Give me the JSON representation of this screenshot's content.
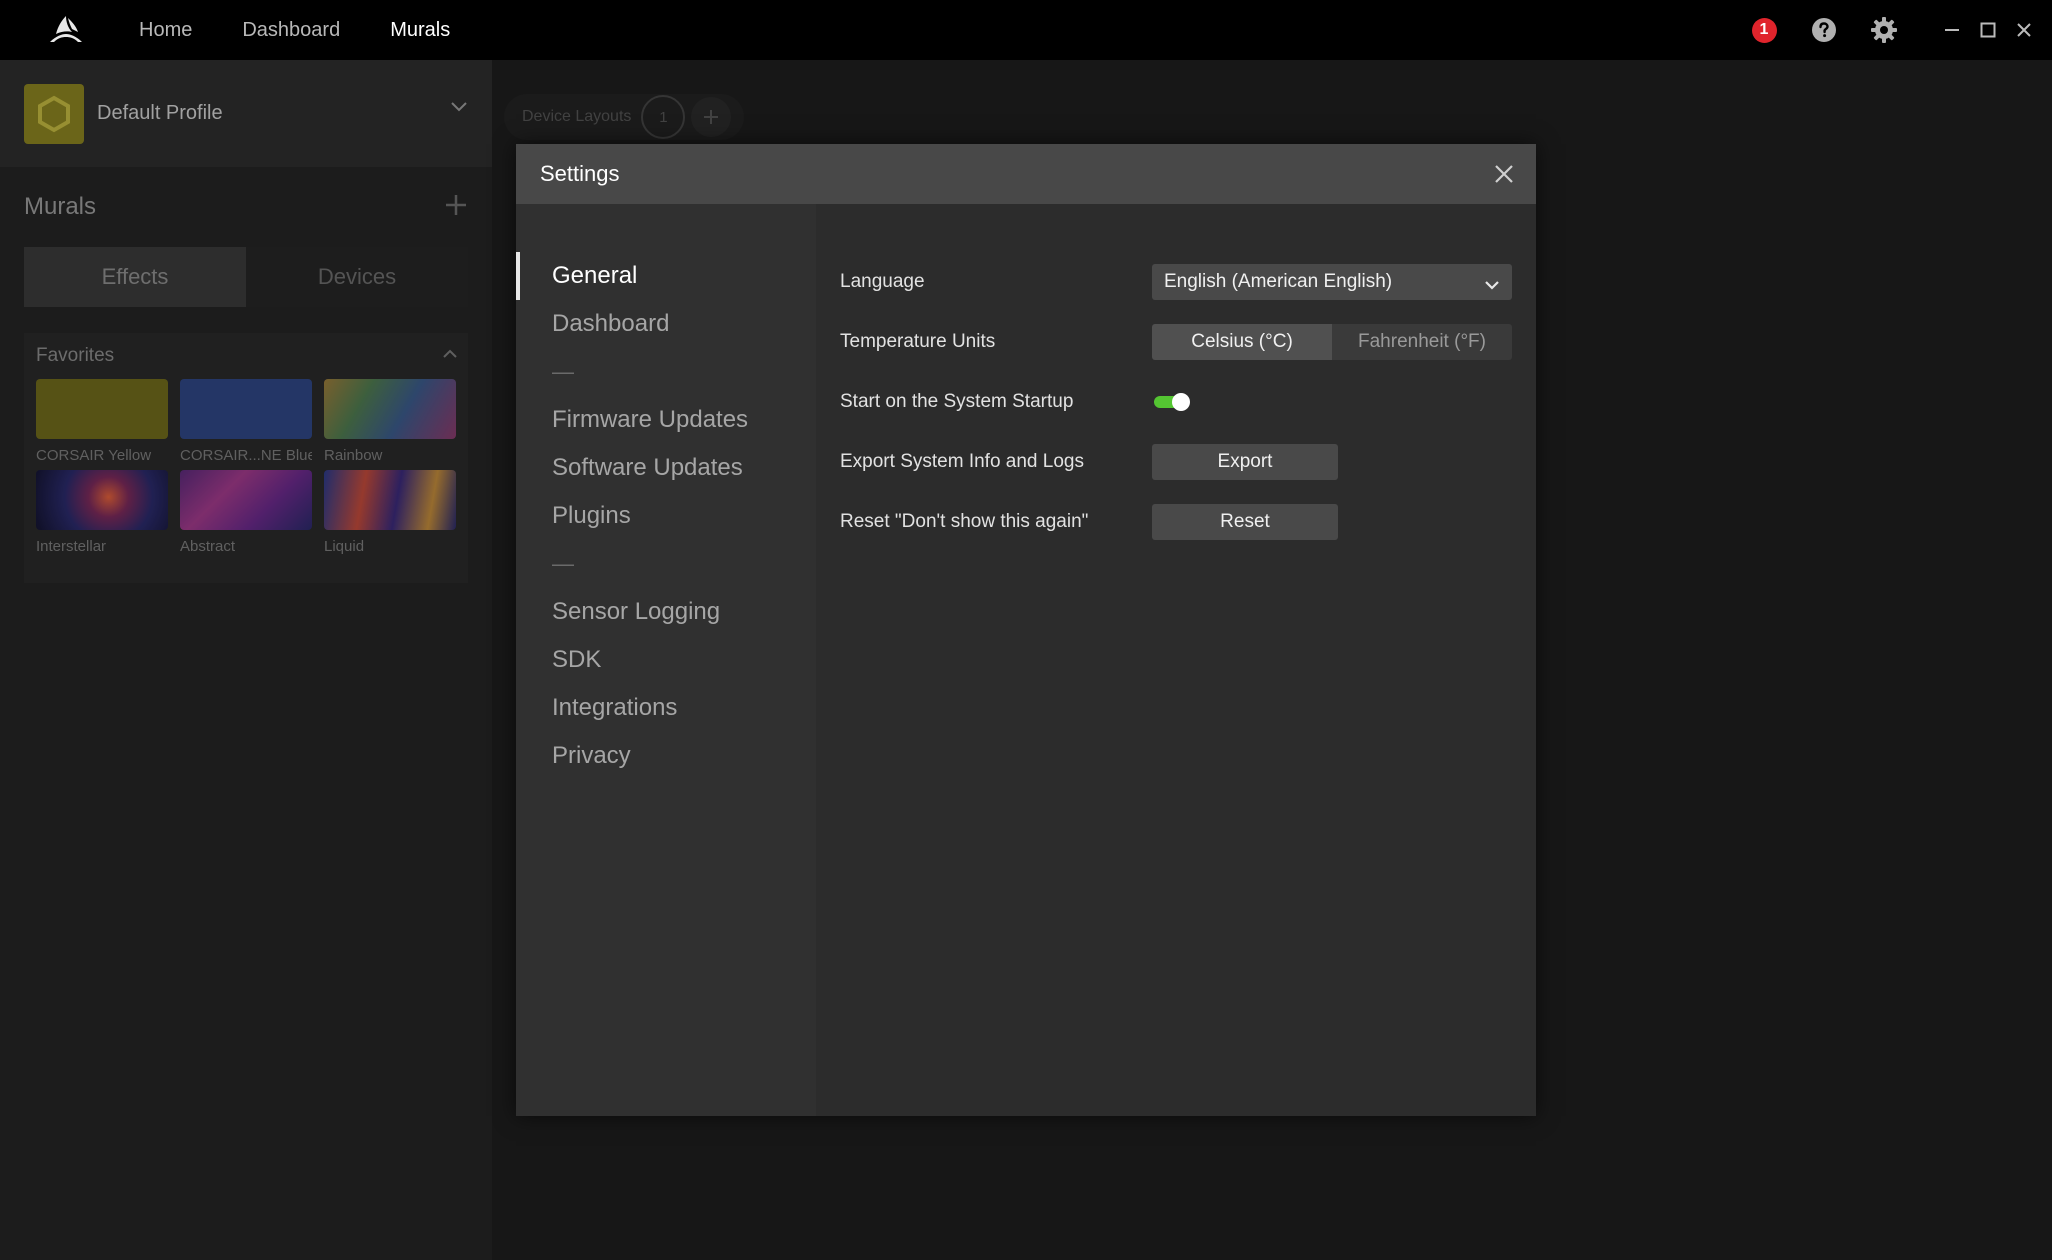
{
  "topbar": {
    "nav": [
      {
        "label": "Home",
        "active": false
      },
      {
        "label": "Dashboard",
        "active": false
      },
      {
        "label": "Murals",
        "active": true
      }
    ],
    "notification_count": "1",
    "icons": [
      "corsair-logo-icon",
      "help-icon",
      "gear-icon",
      "minimize-icon",
      "maximize-icon",
      "close-icon"
    ]
  },
  "sidebar": {
    "profile_name": "Default Profile",
    "section_title": "Murals",
    "tabs": [
      {
        "label": "Effects",
        "active": true
      },
      {
        "label": "Devices",
        "active": false
      }
    ],
    "favorites": {
      "title": "Favorites",
      "items": [
        {
          "label": "CORSAIR Yellow"
        },
        {
          "label": "CORSAIR...NE Blue"
        },
        {
          "label": "Rainbow"
        },
        {
          "label": "Interstellar"
        },
        {
          "label": "Abstract"
        },
        {
          "label": "Liquid"
        }
      ]
    }
  },
  "main": {
    "device_layouts_label": "Device Layouts",
    "device_layouts_count": "1"
  },
  "settings": {
    "title": "Settings",
    "nav": [
      {
        "label": "General",
        "active": true
      },
      {
        "label": "Dashboard"
      },
      {
        "label": "—",
        "separator": true
      },
      {
        "label": "Firmware Updates"
      },
      {
        "label": "Software Updates"
      },
      {
        "label": "Plugins"
      },
      {
        "label": "—",
        "separator": true
      },
      {
        "label": "Sensor Logging"
      },
      {
        "label": "SDK"
      },
      {
        "label": "Integrations"
      },
      {
        "label": "Privacy"
      }
    ],
    "general": {
      "language_label": "Language",
      "language_value": "English (American English)",
      "temp_label": "Temperature Units",
      "temp_options": [
        "Celsius (°C)",
        "Fahrenheit (°F)"
      ],
      "temp_selected": "Celsius (°C)",
      "startup_label": "Start on the System Startup",
      "startup_enabled": true,
      "export_label": "Export System Info and Logs",
      "export_button": "Export",
      "reset_label": "Reset \"Don't show this again\"",
      "reset_button": "Reset"
    }
  },
  "colors": {
    "accent_toggle": "#54c532",
    "notification": "#e0242c",
    "profile_swatch": "#8a8220"
  }
}
